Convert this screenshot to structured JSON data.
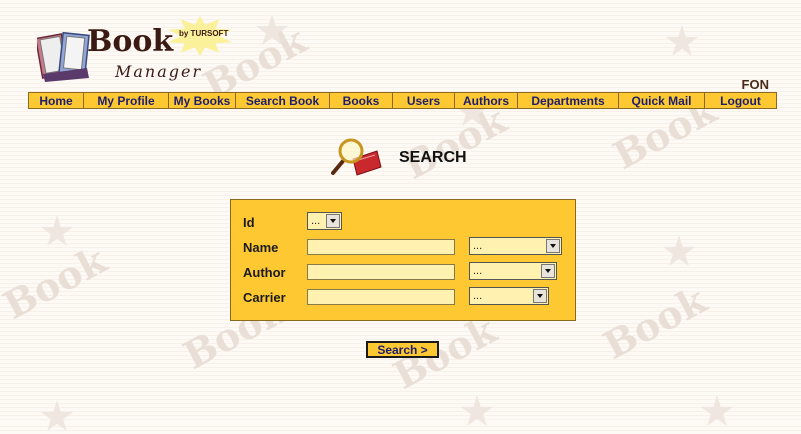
{
  "logo": {
    "word1": "Book",
    "word2": "Manager",
    "by": "by TURSOFT"
  },
  "user": {
    "name": "FON"
  },
  "nav": {
    "items": [
      {
        "id": "home",
        "label": "Home"
      },
      {
        "id": "my-profile",
        "label": "My Profile"
      },
      {
        "id": "my-books",
        "label": "My Books"
      },
      {
        "id": "search-book",
        "label": "Search Book"
      },
      {
        "id": "books",
        "label": "Books"
      },
      {
        "id": "users",
        "label": "Users"
      },
      {
        "id": "authors",
        "label": "Authors"
      },
      {
        "id": "departments",
        "label": "Departments"
      },
      {
        "id": "quick-mail",
        "label": "Quick Mail"
      },
      {
        "id": "logout",
        "label": "Logout"
      }
    ]
  },
  "page": {
    "title": "SEARCH",
    "icon": "magnifier-book-icon"
  },
  "form": {
    "id": {
      "label": "Id",
      "selected": "..."
    },
    "name": {
      "label": "Name",
      "value": "",
      "selected": "..."
    },
    "author": {
      "label": "Author",
      "value": "",
      "selected": "..."
    },
    "carrier": {
      "label": "Carrier",
      "value": "",
      "selected": "..."
    },
    "submit_label": "Search >"
  },
  "colors": {
    "accent": "#fec832",
    "border": "#8a6a1e",
    "nav_text": "#1e1e6e",
    "field": "#fff1b0"
  }
}
